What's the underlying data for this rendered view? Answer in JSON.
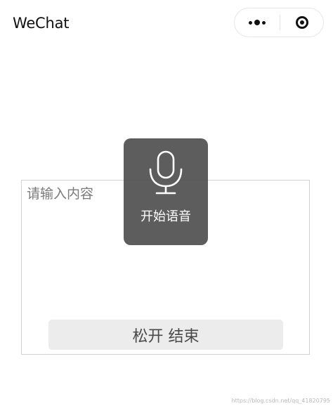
{
  "nav": {
    "title": "WeChat",
    "more_icon": "more-dots-icon",
    "close_icon": "close-target-icon"
  },
  "input": {
    "placeholder": "请输入内容"
  },
  "voice_toast": {
    "label": "开始语音",
    "icon": "microphone-icon"
  },
  "record_button": {
    "label": "松开 结束"
  },
  "watermark": "https://blog.csdn.net/qq_41820795",
  "colors": {
    "toast_background": "#535353",
    "button_background": "#ececec",
    "border": "#d2d2d2",
    "placeholder": "#7a7a7a"
  }
}
